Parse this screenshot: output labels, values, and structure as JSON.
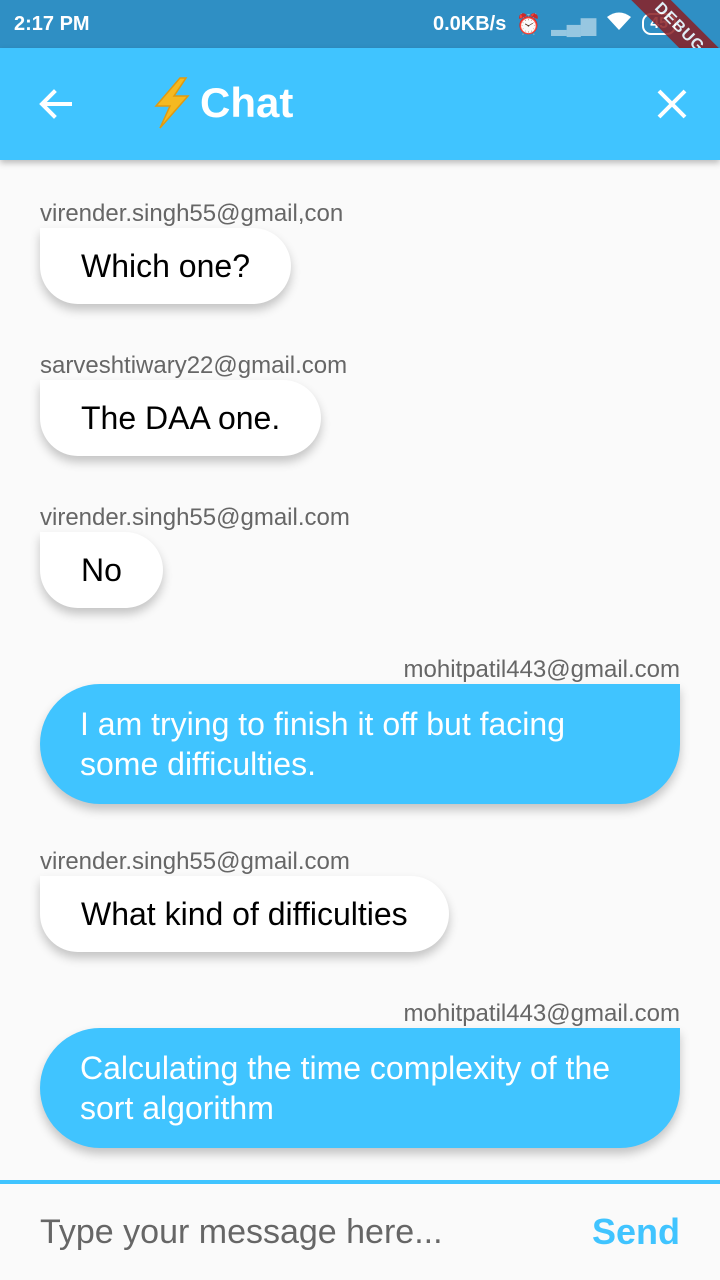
{
  "status_bar": {
    "time": "2:17 PM",
    "speed": "0.0KB/s",
    "battery": "45",
    "debug_label": "DEBUG",
    "icons": [
      "alarm-icon",
      "signal-icon",
      "wifi-icon",
      "battery-icon"
    ]
  },
  "app_bar": {
    "title": "Chat",
    "back_icon": "arrow-back-icon",
    "bolt_icon": "lightning-bolt-icon",
    "close_icon": "close-icon",
    "color": "#40c4ff"
  },
  "messages": [
    {
      "sender": "virender.singh55@gmail,con",
      "text": "Which one?",
      "mine": false
    },
    {
      "sender": "sarveshtiwary22@gmail.com",
      "text": "The DAA one.",
      "mine": false
    },
    {
      "sender": "virender.singh55@gmail.com",
      "text": "No",
      "mine": false
    },
    {
      "sender": "mohitpatil443@gmail.com",
      "text": "I am trying to finish it off but facing some difficulties.",
      "mine": true
    },
    {
      "sender": "virender.singh55@gmail.com",
      "text": "What kind of difficulties",
      "mine": false
    },
    {
      "sender": "mohitpatil443@gmail.com",
      "text": "Calculating the time complexity of the sort algorithm",
      "mine": true
    }
  ],
  "composer": {
    "placeholder": "Type your message here...",
    "value": "",
    "send_label": "Send"
  }
}
